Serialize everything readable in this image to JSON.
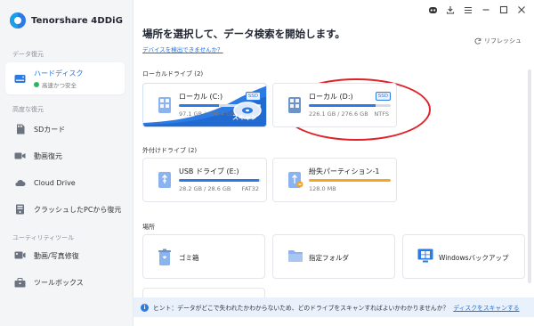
{
  "app": {
    "name": "Tenorshare 4DDiG"
  },
  "sidebar": {
    "section_data_recovery": "データ復元",
    "hard_disk": {
      "label": "ハードディスク",
      "status": "高速かつ安全"
    },
    "section_advanced": "高度な復元",
    "advanced_items": [
      {
        "label": "SDカード"
      },
      {
        "label": "動画復元"
      },
      {
        "label": "Cloud Drive"
      },
      {
        "label": "クラッシュしたPCから復元"
      }
    ],
    "section_utility": "ユーティリティツール",
    "utility_items": [
      {
        "label": "動画/写真修復"
      },
      {
        "label": "ツールボックス"
      }
    ]
  },
  "window": {
    "controls": [
      "robot-icon",
      "download-icon",
      "menu-icon",
      "minimize-icon",
      "maximize-icon",
      "close-icon"
    ]
  },
  "main": {
    "title": "場所を選択して、データ検索を開始します。",
    "detect_link": "デバイスを検出できませんか？",
    "refresh_label": "リフレッシュ",
    "local_drives_label": "ローカルドライブ (2)",
    "local_drives": [
      {
        "name": "ローカル (C:)",
        "usage": "97.1 GB / 199.4 GB",
        "badge": "SSD",
        "scan_label": "スキャン",
        "fill_fraction": 0.49
      },
      {
        "name": "ローカル (D:)",
        "usage": "226.1 GB / 276.6 GB",
        "fs": "NTFS",
        "badge": "SSD",
        "fill_fraction": 0.82
      }
    ],
    "external_drives_label": "外付けドライブ (2)",
    "external_drives": [
      {
        "name": "USB ドライブ (E:)",
        "usage": "28.2 GB / 28.6 GB",
        "fs": "FAT32",
        "fill_fraction": 0.98
      },
      {
        "name": "紛失パーティション-1",
        "usage": "128.0 MB",
        "fill_fraction": 1.0,
        "fill_color": "#f5a623"
      }
    ],
    "locations_label": "場所",
    "locations": [
      {
        "name": "ゴミ箱"
      },
      {
        "name": "指定フォルダ"
      },
      {
        "name": "Windowsバックアップ"
      }
    ]
  },
  "hint": {
    "text": "ヒント：データがどこで失われたかわからないため、どのドライブをスキャンすればよいかわかりませんか？",
    "link": "ディスクをスキャンする"
  },
  "colors": {
    "accent": "#2c7be5",
    "highlight": "#e0222a",
    "warning": "#f5a623"
  }
}
